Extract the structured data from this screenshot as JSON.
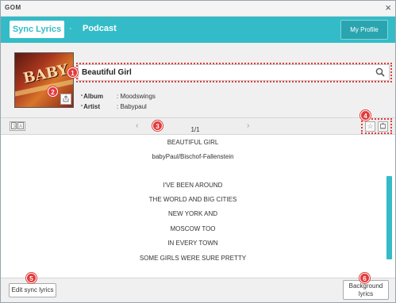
{
  "window": {
    "title": "GOM",
    "close_glyph": "×"
  },
  "tabs": {
    "active": "Sync Lyrics",
    "separator": "·",
    "second": "Podcast",
    "profile_button": "My Profile"
  },
  "header": {
    "song_title": "Beautiful Girl",
    "album_key": "Album",
    "album_value": ": Moodswings",
    "artist_key": "Artist",
    "artist_value": ": Babypaul",
    "share_icon": "share-icon",
    "search_icon": "search-icon"
  },
  "toolbar": {
    "translate_icon": "translate-icon",
    "prev": "‹",
    "next": "›",
    "page": "1/1",
    "favorite_icon": "star-icon",
    "report_icon": "report-icon"
  },
  "lyrics": [
    "BEAUTIFUL GIRL",
    "babyPaul/Bischof-Fallenstein",
    "",
    "I'VE BEEN AROUND",
    "THE WORLD AND BIG CITIES",
    "NEW YORK AND",
    "MOSCOW TOO",
    "IN EVERY TOWN",
    "SOME GIRLS WERE SURE PRETTY"
  ],
  "footer": {
    "edit_button": "Edit sync lyrics",
    "background_button_line1": "Background",
    "background_button_line2": "lyrics"
  },
  "callouts": [
    "1",
    "2",
    "3",
    "4",
    "5",
    "6"
  ],
  "colors": {
    "accent": "#33bcc8",
    "callout": "#e23b3b"
  }
}
